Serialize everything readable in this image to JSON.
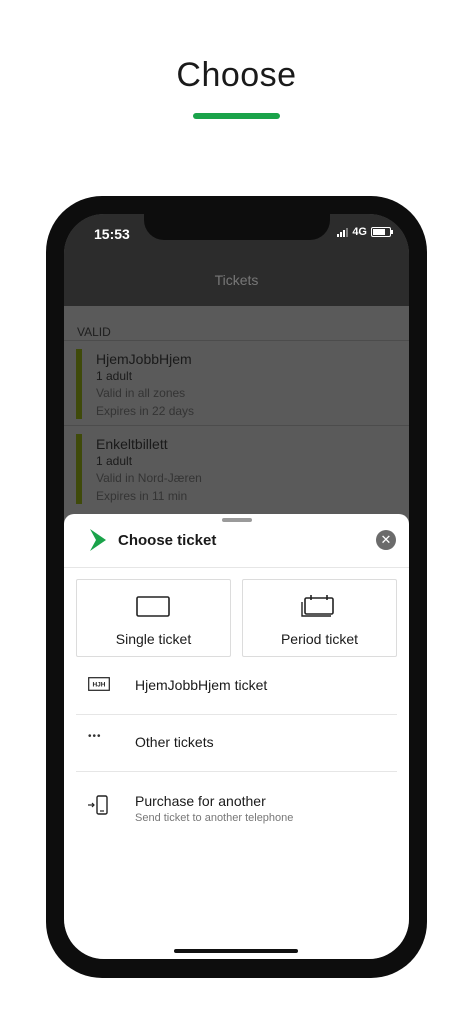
{
  "hero": {
    "title": "Choose",
    "underline_color": "#1aa34a"
  },
  "status_bar": {
    "time": "15:53",
    "network": "4G"
  },
  "nav": {
    "title": "Tickets"
  },
  "valid_section": {
    "label": "VALID",
    "tickets": [
      {
        "name": "HjemJobbHjem",
        "passengers": "1 adult",
        "zones": "Valid in all zones",
        "expiry": "Expires in 22 days"
      },
      {
        "name": "Enkeltbillett",
        "passengers": "1 adult",
        "zones": "Valid in Nord-Jæren",
        "expiry": "Expires in 11 min"
      }
    ]
  },
  "sheet": {
    "title": "Choose ticket",
    "close_icon": "close-icon",
    "brand_icon": "brand-chevron-icon",
    "brand_color": "#1aa34a",
    "tiles": [
      {
        "label": "Single ticket",
        "icon": "single-ticket-icon"
      },
      {
        "label": "Period ticket",
        "icon": "period-ticket-icon"
      }
    ],
    "rows": [
      {
        "label": "HjemJobbHjem ticket",
        "icon": "hjh-ticket-icon",
        "icon_text": "HJH"
      },
      {
        "label": "Other tickets",
        "icon": "more-dots-icon",
        "icon_text": "•••"
      },
      {
        "label": "Purchase for another",
        "sublabel": "Send ticket to another telephone",
        "icon": "phone-transfer-icon"
      }
    ]
  }
}
